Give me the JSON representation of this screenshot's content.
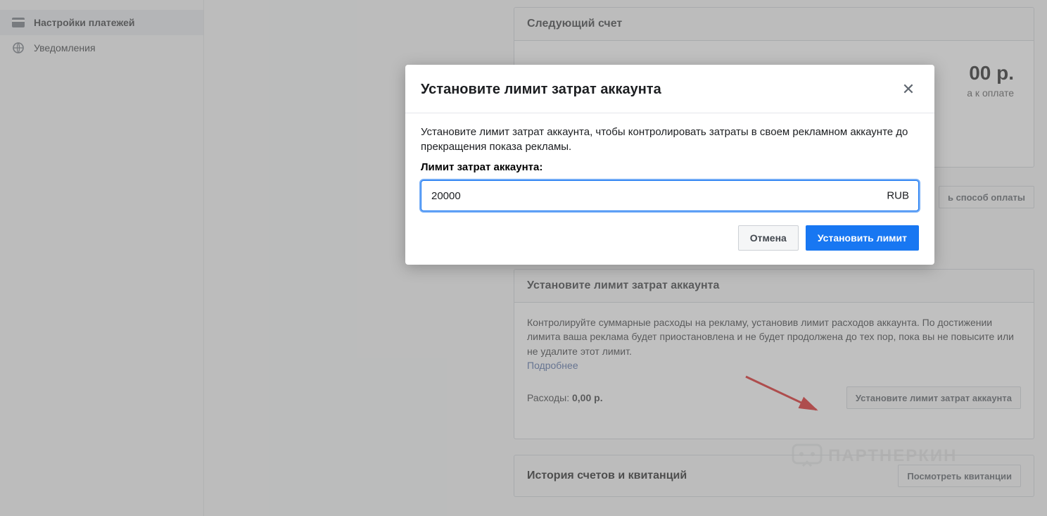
{
  "sidebar": {
    "items": [
      {
        "label": "Настройки платежей"
      },
      {
        "label": "Уведомления"
      }
    ]
  },
  "nextBill": {
    "header": "Следующий счет",
    "amount": "00 р.",
    "due": "а к оплате"
  },
  "addPayment": {
    "label": "ь способ оплаты"
  },
  "limit": {
    "header": "Установите лимит затрат аккаунта",
    "desc": "Контролируйте суммарные расходы на рекламу, установив лимит расходов аккаунта. По достижении лимита ваша реклама будет приостановлена и не будет продолжена до тех пор, пока вы не повысите или не удалите этот лимит.",
    "more": "Подробнее",
    "expensesLabel": "Расходы:",
    "expensesValue": "0,00 р.",
    "buttonLabel": "Установите лимит затрат аккаунта"
  },
  "history": {
    "title": "История счетов и квитанций",
    "buttonLabel": "Посмотреть квитанции"
  },
  "modal": {
    "title": "Установите лимит затрат аккаунта",
    "desc": "Установите лимит затрат аккаунта, чтобы контролировать затраты в своем рекламном аккаунте до прекращения показа рекламы.",
    "label": "Лимит затрат аккаунта:",
    "inputValue": "20000",
    "currency": "RUB",
    "cancel": "Отмена",
    "confirm": "Установить лимит"
  },
  "watermark": {
    "text": "ПАРТНЕРКИН"
  }
}
